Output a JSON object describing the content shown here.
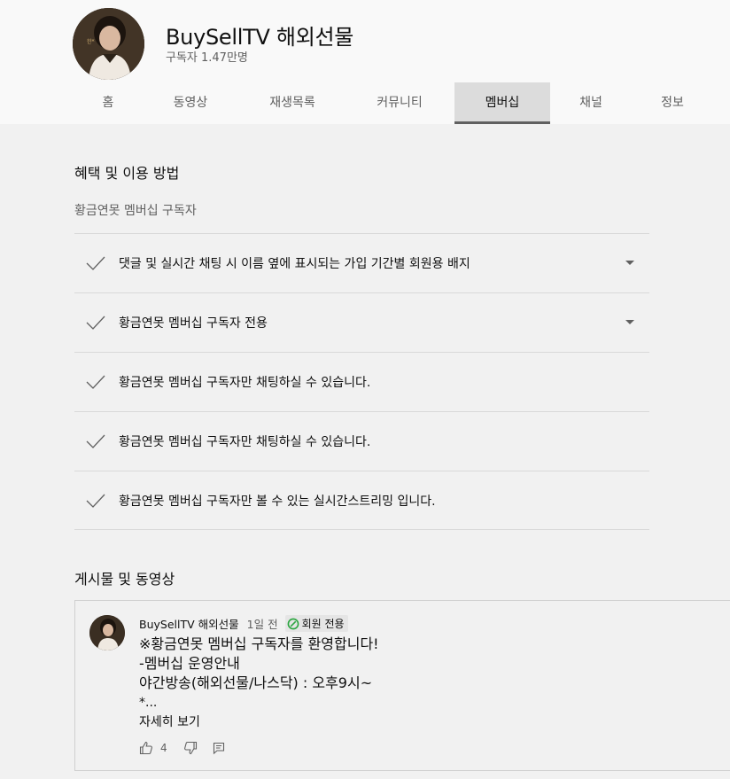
{
  "channel": {
    "name": "BuySellTV 해외선물",
    "subscribers": "구독자 1.47만명"
  },
  "tabs": [
    "홈",
    "동영상",
    "재생목록",
    "커뮤니티",
    "멤버십",
    "채널",
    "정보"
  ],
  "active_tab": "멤버십",
  "benefits": {
    "title": "혜택 및 이용 방법",
    "tier_name": "황금연못 멤버십 구독자",
    "perks": [
      {
        "text": "댓글 및 실시간 채팅 시 이름 옆에 표시되는 가입 기간별 회원용 배지",
        "expandable": true
      },
      {
        "text": "황금연못 멤버십 구독자 전용",
        "expandable": true
      },
      {
        "text": "황금연못 멤버십 구독자만 채팅하실 수 있습니다.",
        "expandable": false
      },
      {
        "text": "황금연못 멤버십 구독자만 채팅하실 수 있습니다.",
        "expandable": false
      },
      {
        "text": "황금연못 멤버십 구독자만 볼 수 있는 실시간스트리밍 입니다.",
        "expandable": false
      }
    ]
  },
  "posts_section": {
    "title": "게시물 및 동영상"
  },
  "post": {
    "author": "BuySellTV 해외선물",
    "time": "1일 전",
    "badge": "회원 전용",
    "lines": [
      "※황금연못 멤버십 구독자를 환영합니다!",
      "-멤버십 운영안내",
      "야간방송(해외선물/나스닥) : 오후9시~",
      "*..."
    ],
    "read_more": "자세히 보기",
    "likes": "4"
  },
  "colors": {
    "accent_green": "#2ba640",
    "active_tab_bg": "#dcdcdc",
    "divider": "#d9d9d9"
  }
}
